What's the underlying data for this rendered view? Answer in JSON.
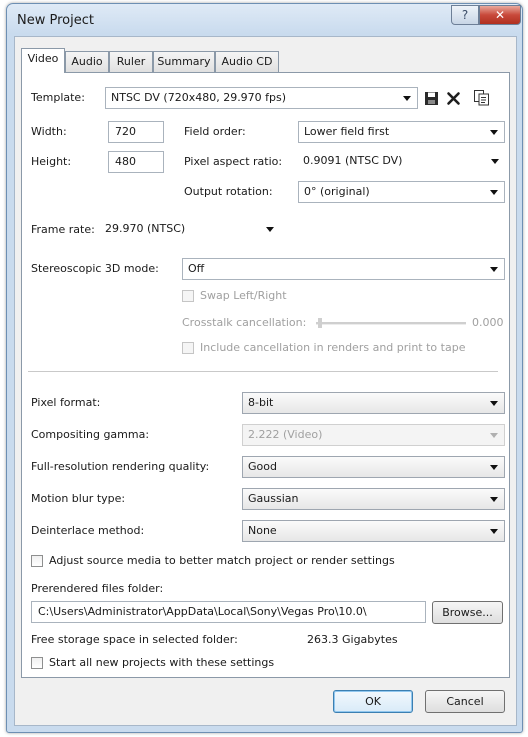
{
  "window": {
    "title": "New Project",
    "help_glyph": "?",
    "close_glyph": "✕"
  },
  "tabs": [
    {
      "label": "Video",
      "active": true
    },
    {
      "label": "Audio"
    },
    {
      "label": "Ruler"
    },
    {
      "label": "Summary"
    },
    {
      "label": "Audio CD"
    }
  ],
  "video": {
    "template_label": "Template:",
    "template_value": "NTSC DV (720x480, 29.970 fps)",
    "width_label": "Width:",
    "width_value": "720",
    "height_label": "Height:",
    "height_value": "480",
    "field_order_label": "Field order:",
    "field_order_value": "Lower field first",
    "pixel_aspect_label": "Pixel aspect ratio:",
    "pixel_aspect_value": "0.9091 (NTSC DV)",
    "output_rotation_label": "Output rotation:",
    "output_rotation_value": "0° (original)",
    "frame_rate_label": "Frame rate:",
    "frame_rate_value": "29.970 (NTSC)",
    "stereo_label": "Stereoscopic 3D mode:",
    "stereo_value": "Off",
    "swap_label": "Swap Left/Right",
    "crosstalk_label": "Crosstalk cancellation:",
    "crosstalk_value": "0.000",
    "include_cancel_label": "Include cancellation in renders and print to tape",
    "pixel_format_label": "Pixel format:",
    "pixel_format_value": "8-bit",
    "gamma_label": "Compositing gamma:",
    "gamma_value": "2.222 (Video)",
    "render_quality_label": "Full-resolution rendering quality:",
    "render_quality_value": "Good",
    "motion_blur_label": "Motion blur type:",
    "motion_blur_value": "Gaussian",
    "deinterlace_label": "Deinterlace method:",
    "deinterlace_value": "None",
    "adjust_source_label": "Adjust source media to better match project or render settings",
    "prerender_label": "Prerendered files folder:",
    "prerender_path": "C:\\Users\\Administrator\\AppData\\Local\\Sony\\Vegas Pro\\10.0\\",
    "browse_label": "Browse...",
    "free_space_label": "Free storage space in selected folder:",
    "free_space_value": "263.3 Gigabytes",
    "start_all_label": "Start all new projects with these settings"
  },
  "footer": {
    "ok_label": "OK",
    "cancel_label": "Cancel"
  },
  "icons": {
    "save": "save-icon",
    "delete": "delete-icon",
    "copy": "copy-icon"
  }
}
